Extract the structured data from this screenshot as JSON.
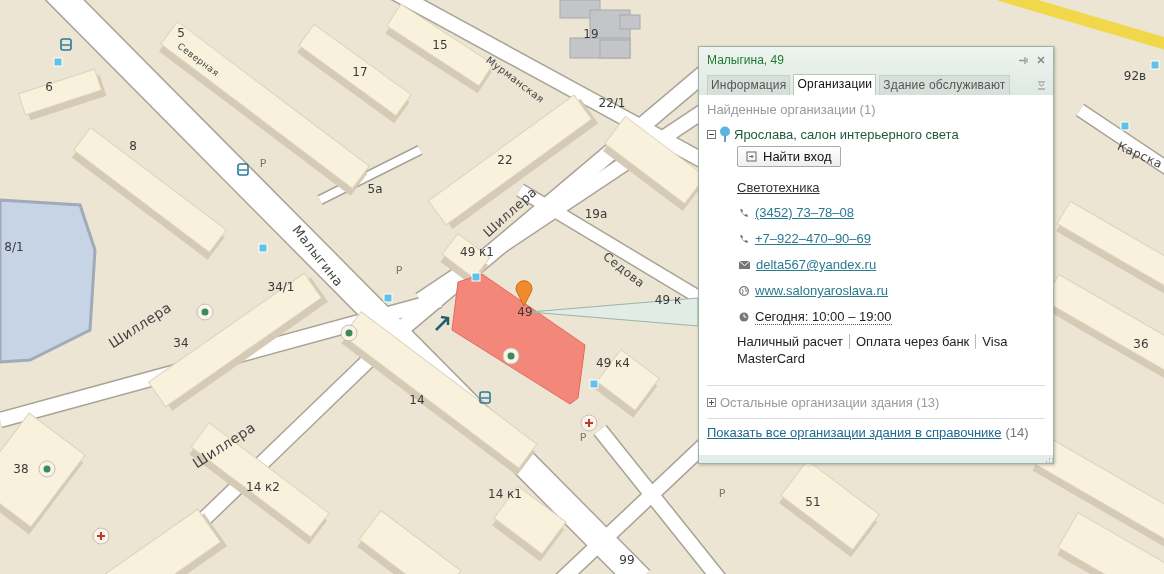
{
  "map": {
    "house_numbers": [
      "5",
      "15",
      "19",
      "92в",
      "6",
      "17",
      "22/1",
      "8",
      "22",
      "5а",
      "19а",
      "8/1",
      "49 к1",
      "34/1",
      "49 к",
      "49",
      "49 к4",
      "34",
      "36",
      "14",
      "38",
      "14 к2",
      "14 к1",
      "51",
      "99"
    ],
    "street_names": [
      "Северная",
      "Мурманская",
      "Малыгина",
      "Шиллера",
      "Седова",
      "Шиллера",
      "Шиллера",
      "Карска"
    ],
    "parking_signs": [
      "Р",
      "Р",
      "Р",
      "Р"
    ]
  },
  "popup": {
    "title": "Малыгина, 49",
    "tabs": [
      {
        "label": "Информация",
        "selected": false
      },
      {
        "label": "Организации",
        "selected": true
      },
      {
        "label": "Здание обслуживают",
        "selected": false
      }
    ],
    "found_header": "Найденные организации (1)",
    "organization": {
      "name": "Ярослава, салон интерьерного света",
      "expanded": true,
      "entrance_button": "Найти вход",
      "category": "Светотехника",
      "contacts": [
        {
          "kind": "phone",
          "text": "(3452) 73–78–08"
        },
        {
          "kind": "phone",
          "text": "+7–922–470–90–69"
        },
        {
          "kind": "email",
          "text": "delta567@yandex.ru"
        },
        {
          "kind": "web",
          "text": "www.salonyaroslava.ru"
        },
        {
          "kind": "hours",
          "text": "Сегодня: 10:00 – 19:00"
        }
      ],
      "payment_methods": [
        "Наличный расчет",
        "Оплата через банк",
        "Visa MasterCard"
      ]
    },
    "other_orgs": {
      "label": "Остальные организации здания (13)",
      "expanded": false
    },
    "directory_link": {
      "link": "Показать все организации здания в справочнике",
      "count": "(14)"
    }
  }
}
